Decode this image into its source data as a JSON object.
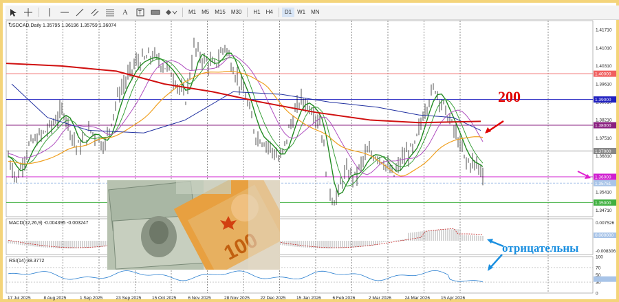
{
  "toolbar": {
    "tools": [
      "cursor-icon",
      "crosshair-icon",
      "vertical-line-icon",
      "horizontal-line-icon",
      "trendline-icon",
      "channel-icon",
      "fibo-icon",
      "text-icon",
      "label-icon",
      "rectangle-icon",
      "shapes-icon"
    ],
    "timeframes": [
      "M1",
      "M5",
      "M15",
      "M30",
      "H1",
      "H4",
      "D1",
      "W1",
      "MN"
    ],
    "active_timeframe": "D1"
  },
  "chart": {
    "title": "USDCAD,Daily  1.35795 1.36196 1.35759 1.36074",
    "price_labels": [
      "1.41710",
      "1.41010",
      "1.40310",
      "1.39610",
      "1.38910",
      "1.38210",
      "1.37510",
      "1.36810",
      "1.35410",
      "1.34710"
    ],
    "level_labels": [
      {
        "text": "1.40000",
        "color": "#f06060"
      },
      {
        "text": "1.39000",
        "color": "#2020c0"
      },
      {
        "text": "1.38000",
        "color": "#8a2080"
      },
      {
        "text": "1.37000",
        "color": "#888888"
      },
      {
        "text": "1.36000",
        "color": "#d020d0"
      },
      {
        "text": "1.35751",
        "color": "#a8c4e8"
      },
      {
        "text": "1.35000",
        "color": "#40b040"
      }
    ],
    "date_labels": [
      "17 Jul 2025",
      "8 Aug 2025",
      "1 Sep 2025",
      "23 Sep 2025",
      "15 Oct 2025",
      "6 Nov 2025",
      "28 Nov 2025",
      "22 Dec 2025",
      "15 Jan 2026",
      "6 Feb 2026",
      "2 Mar 2026",
      "24 Mar 2026",
      "15 Apr 2026"
    ],
    "macd": {
      "title": "MACD(12,26,9) -0.004395 -0.003247",
      "labels": [
        "0.007526",
        "0.000000",
        "-0.008306"
      ]
    },
    "rsi": {
      "title": "RSI(14) 38.3772",
      "labels": [
        "100",
        "70",
        "50",
        "30",
        "0"
      ]
    },
    "annotations": {
      "ma200": "200",
      "negative": "отрицательны"
    }
  },
  "colors": {
    "ma200": "#d01010",
    "ma50": "#2030a0",
    "orange": "#f0a020",
    "purple": "#b050c0",
    "green": "#208a20",
    "price": "#000000"
  }
}
